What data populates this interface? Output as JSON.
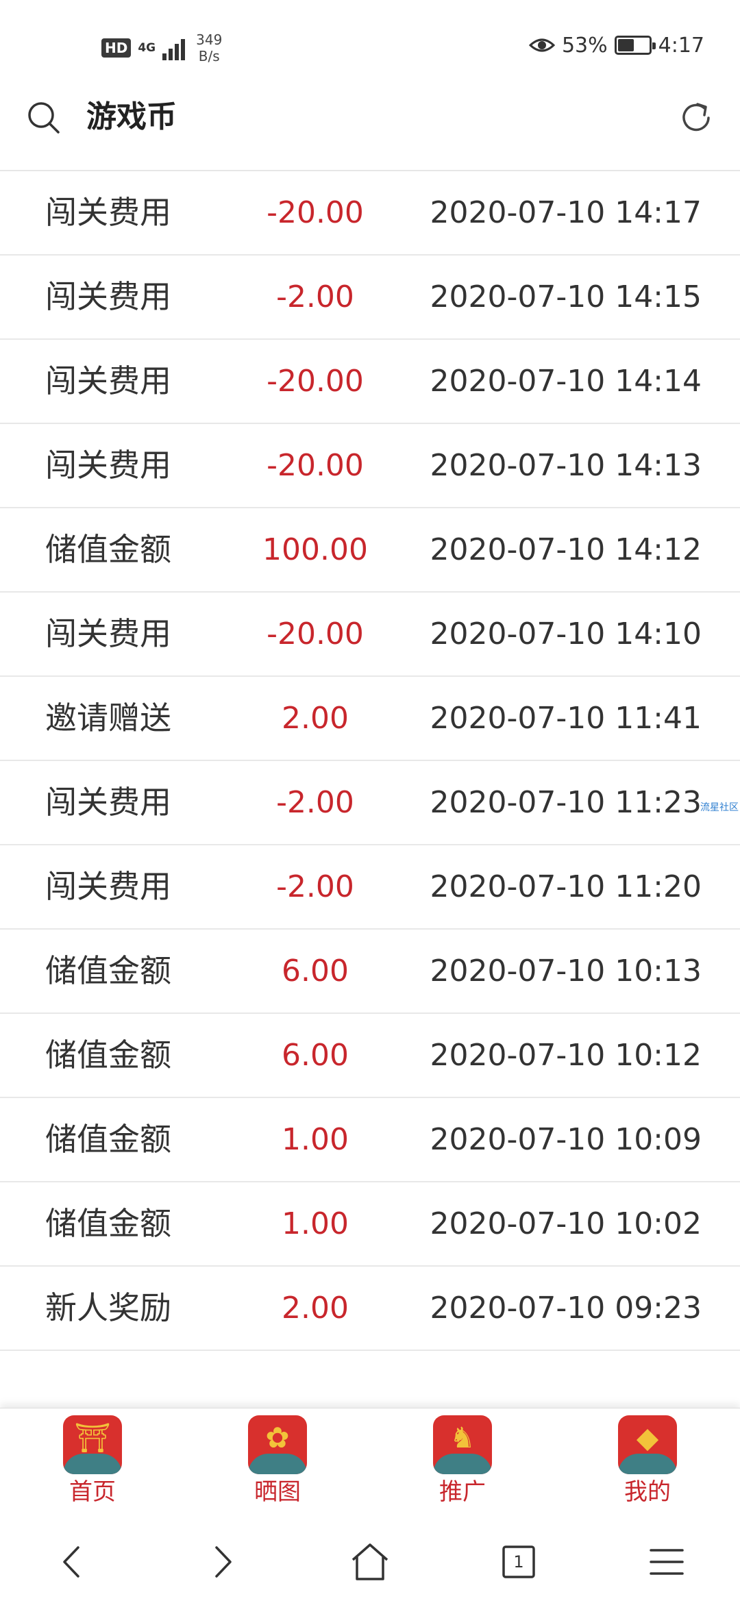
{
  "status_bar": {
    "hd": "HD",
    "network": "4G",
    "speed_value": "349",
    "speed_unit": "B/s",
    "battery_percent": "53%",
    "battery_level": 0.53,
    "time": "4:17"
  },
  "header": {
    "title": "游戏币"
  },
  "transactions": [
    {
      "type": "闯关费用",
      "amount": "-20.00",
      "time": "2020-07-10 14:17"
    },
    {
      "type": "闯关费用",
      "amount": "-2.00",
      "time": "2020-07-10 14:15"
    },
    {
      "type": "闯关费用",
      "amount": "-20.00",
      "time": "2020-07-10 14:14"
    },
    {
      "type": "闯关费用",
      "amount": "-20.00",
      "time": "2020-07-10 14:13"
    },
    {
      "type": "储值金额",
      "amount": "100.00",
      "time": "2020-07-10 14:12"
    },
    {
      "type": "闯关费用",
      "amount": "-20.00",
      "time": "2020-07-10 14:10"
    },
    {
      "type": "邀请赠送",
      "amount": "2.00",
      "time": "2020-07-10 11:41"
    },
    {
      "type": "闯关费用",
      "amount": "-2.00",
      "time": "2020-07-10 11:23"
    },
    {
      "type": "闯关费用",
      "amount": "-2.00",
      "time": "2020-07-10 11:20"
    },
    {
      "type": "储值金额",
      "amount": "6.00",
      "time": "2020-07-10 10:13"
    },
    {
      "type": "储值金额",
      "amount": "6.00",
      "time": "2020-07-10 10:12"
    },
    {
      "type": "储值金额",
      "amount": "1.00",
      "time": "2020-07-10 10:09"
    },
    {
      "type": "储值金额",
      "amount": "1.00",
      "time": "2020-07-10 10:02"
    },
    {
      "type": "新人奖励",
      "amount": "2.00",
      "time": "2020-07-10 09:23"
    }
  ],
  "watermark": "流星社区",
  "tabbar": {
    "items": [
      {
        "label": "首页",
        "icon": "home-gate-icon"
      },
      {
        "label": "晒图",
        "icon": "flower-icon"
      },
      {
        "label": "推广",
        "icon": "mouse-icon"
      },
      {
        "label": "我的",
        "icon": "gold-ingot-icon"
      }
    ]
  },
  "system_nav": {
    "tab_count": "1"
  },
  "colors": {
    "accent_red": "#c8262c",
    "icon_red": "#d8302d",
    "cloud_teal": "#3f7f85"
  }
}
